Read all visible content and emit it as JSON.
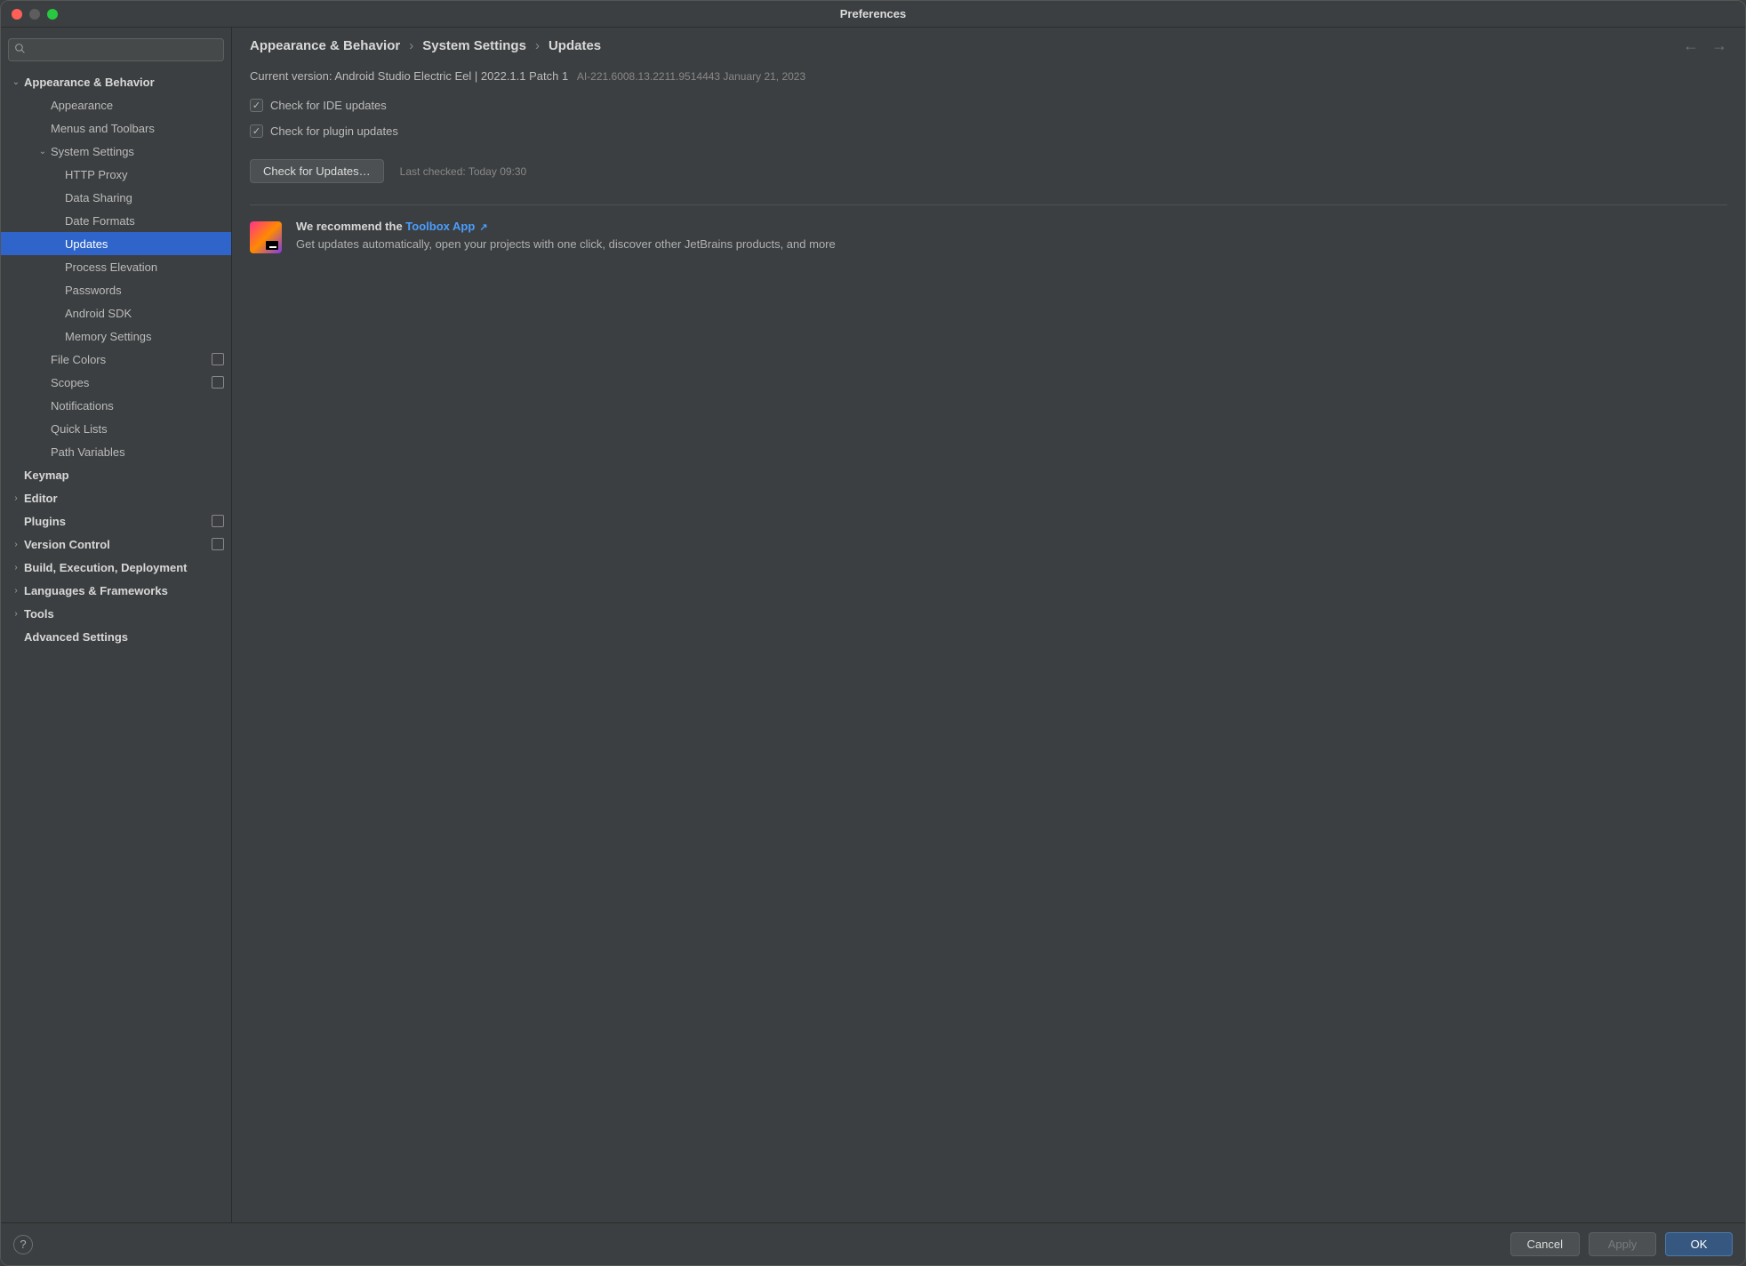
{
  "window": {
    "title": "Preferences"
  },
  "search": {
    "placeholder": ""
  },
  "sidebar": {
    "items": [
      {
        "label": "Appearance & Behavior",
        "depth": 0,
        "bold": true,
        "arrow": "down",
        "selected": false,
        "badge": false
      },
      {
        "label": "Appearance",
        "depth": 1,
        "bold": false,
        "arrow": "",
        "selected": false,
        "badge": false
      },
      {
        "label": "Menus and Toolbars",
        "depth": 1,
        "bold": false,
        "arrow": "",
        "selected": false,
        "badge": false
      },
      {
        "label": "System Settings",
        "depth": 1,
        "bold": false,
        "arrow": "down",
        "selected": false,
        "badge": false
      },
      {
        "label": "HTTP Proxy",
        "depth": 2,
        "bold": false,
        "arrow": "",
        "selected": false,
        "badge": false
      },
      {
        "label": "Data Sharing",
        "depth": 2,
        "bold": false,
        "arrow": "",
        "selected": false,
        "badge": false
      },
      {
        "label": "Date Formats",
        "depth": 2,
        "bold": false,
        "arrow": "",
        "selected": false,
        "badge": false
      },
      {
        "label": "Updates",
        "depth": 2,
        "bold": false,
        "arrow": "",
        "selected": true,
        "badge": false
      },
      {
        "label": "Process Elevation",
        "depth": 2,
        "bold": false,
        "arrow": "",
        "selected": false,
        "badge": false
      },
      {
        "label": "Passwords",
        "depth": 2,
        "bold": false,
        "arrow": "",
        "selected": false,
        "badge": false
      },
      {
        "label": "Android SDK",
        "depth": 2,
        "bold": false,
        "arrow": "",
        "selected": false,
        "badge": false
      },
      {
        "label": "Memory Settings",
        "depth": 2,
        "bold": false,
        "arrow": "",
        "selected": false,
        "badge": false
      },
      {
        "label": "File Colors",
        "depth": 1,
        "bold": false,
        "arrow": "",
        "selected": false,
        "badge": true
      },
      {
        "label": "Scopes",
        "depth": 1,
        "bold": false,
        "arrow": "",
        "selected": false,
        "badge": true
      },
      {
        "label": "Notifications",
        "depth": 1,
        "bold": false,
        "arrow": "",
        "selected": false,
        "badge": false
      },
      {
        "label": "Quick Lists",
        "depth": 1,
        "bold": false,
        "arrow": "",
        "selected": false,
        "badge": false
      },
      {
        "label": "Path Variables",
        "depth": 1,
        "bold": false,
        "arrow": "",
        "selected": false,
        "badge": false
      },
      {
        "label": "Keymap",
        "depth": 0,
        "bold": true,
        "arrow": "",
        "selected": false,
        "badge": false
      },
      {
        "label": "Editor",
        "depth": 0,
        "bold": true,
        "arrow": "right",
        "selected": false,
        "badge": false
      },
      {
        "label": "Plugins",
        "depth": 0,
        "bold": true,
        "arrow": "",
        "selected": false,
        "badge": true
      },
      {
        "label": "Version Control",
        "depth": 0,
        "bold": true,
        "arrow": "right",
        "selected": false,
        "badge": true
      },
      {
        "label": "Build, Execution, Deployment",
        "depth": 0,
        "bold": true,
        "arrow": "right",
        "selected": false,
        "badge": false
      },
      {
        "label": "Languages & Frameworks",
        "depth": 0,
        "bold": true,
        "arrow": "right",
        "selected": false,
        "badge": false
      },
      {
        "label": "Tools",
        "depth": 0,
        "bold": true,
        "arrow": "right",
        "selected": false,
        "badge": false
      },
      {
        "label": "Advanced Settings",
        "depth": 0,
        "bold": true,
        "arrow": "",
        "selected": false,
        "badge": false
      }
    ]
  },
  "breadcrumb": {
    "seg1": "Appearance & Behavior",
    "seg2": "System Settings",
    "seg3": "Updates",
    "sep": "›"
  },
  "version": {
    "label": "Current version:",
    "product": "Android Studio Electric Eel | 2022.1.1 Patch 1",
    "build": "AI-221.6008.13.2211.9514443 January 21, 2023"
  },
  "checks": {
    "ide": "Check for IDE updates",
    "plugin": "Check for plugin updates"
  },
  "updateBtn": "Check for Updates…",
  "lastChecked": "Last checked: Today 09:30",
  "promo": {
    "lead": "We recommend the ",
    "link": "Toolbox App",
    "body": "Get updates automatically, open your projects with one click, discover other JetBrains products, and more"
  },
  "footer": {
    "cancel": "Cancel",
    "apply": "Apply",
    "ok": "OK"
  }
}
